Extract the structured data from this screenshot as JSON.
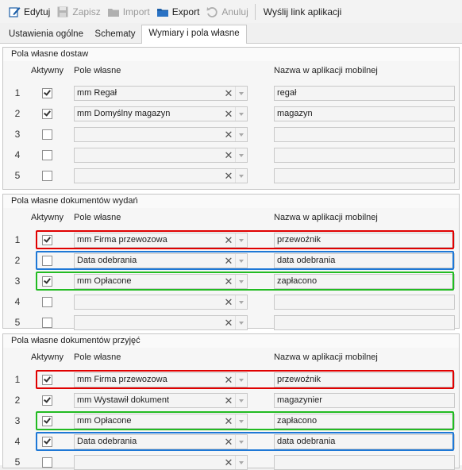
{
  "toolbar": {
    "edit_label": "Edytuj",
    "save_label": "Zapisz",
    "import_label": "Import",
    "export_label": "Export",
    "cancel_label": "Anuluj",
    "send_link_label": "Wyślij link aplikacji"
  },
  "tabs": [
    {
      "label": "Ustawienia ogólne"
    },
    {
      "label": "Schematy"
    },
    {
      "label": "Wymiary i pola własne"
    }
  ],
  "colors": {
    "highlight_red": "#e00000",
    "highlight_blue": "#1e78d6",
    "highlight_green": "#22bb22"
  },
  "groups": [
    {
      "title": "Pola własne dostaw",
      "header_active": "Aktywny",
      "header_field": "Pole własne",
      "header_app_name": "Nazwa w aplikacji mobilnej",
      "rows": [
        {
          "num": "1",
          "checked": true,
          "field": "mm Regał",
          "app_name": "regał",
          "highlight": ""
        },
        {
          "num": "2",
          "checked": true,
          "field": "mm Domyślny magazyn",
          "app_name": "magazyn",
          "highlight": ""
        },
        {
          "num": "3",
          "checked": false,
          "field": "",
          "app_name": "",
          "highlight": ""
        },
        {
          "num": "4",
          "checked": false,
          "field": "",
          "app_name": "",
          "highlight": ""
        },
        {
          "num": "5",
          "checked": false,
          "field": "",
          "app_name": "",
          "highlight": ""
        }
      ]
    },
    {
      "title": "Pola własne dokumentów wydań",
      "header_active": "Aktywny",
      "header_field": "Pole własne",
      "header_app_name": "Nazwa w aplikacji mobilnej",
      "rows": [
        {
          "num": "1",
          "checked": true,
          "field": "mm Firma przewozowa",
          "app_name": "przewoźnik",
          "highlight": "red"
        },
        {
          "num": "2",
          "checked": false,
          "field": "Data odebrania",
          "app_name": "data odebrania",
          "highlight": "blue"
        },
        {
          "num": "3",
          "checked": true,
          "field": "mm Opłacone",
          "app_name": "zapłacono",
          "highlight": "green"
        },
        {
          "num": "4",
          "checked": false,
          "field": "",
          "app_name": "",
          "highlight": ""
        },
        {
          "num": "5",
          "checked": false,
          "field": "",
          "app_name": "",
          "highlight": ""
        }
      ]
    },
    {
      "title": "Pola własne dokumentów przyjęć",
      "header_active": "Aktywny",
      "header_field": "Pole własne",
      "header_app_name": "Nazwa w aplikacji mobilnej",
      "rows": [
        {
          "num": "1",
          "checked": true,
          "field": "mm Firma przewozowa",
          "app_name": "przewoźnik",
          "highlight": "red"
        },
        {
          "num": "2",
          "checked": true,
          "field": "mm Wystawił dokument",
          "app_name": "magazynier",
          "highlight": ""
        },
        {
          "num": "3",
          "checked": true,
          "field": "mm Opłacone",
          "app_name": "zapłacono",
          "highlight": "green"
        },
        {
          "num": "4",
          "checked": true,
          "field": "Data odebrania",
          "app_name": "data odebrania",
          "highlight": "blue"
        },
        {
          "num": "5",
          "checked": false,
          "field": "",
          "app_name": "",
          "highlight": ""
        }
      ]
    }
  ]
}
